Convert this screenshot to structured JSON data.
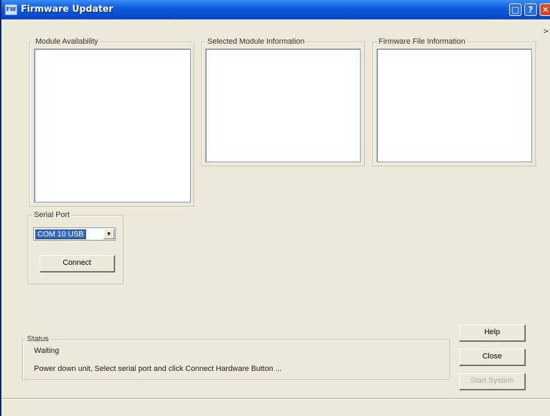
{
  "window": {
    "title": "Firmware Updater",
    "icon_text": "FW",
    "buttons": {
      "maximize": "□",
      "help": "?",
      "close": "✕"
    },
    "overflow_chevron": ">>"
  },
  "panels": {
    "module_availability": {
      "label": "Module Availability"
    },
    "selected_module_info": {
      "label": "Selected Module Information"
    },
    "firmware_file_info": {
      "label": "Firmware File Information"
    }
  },
  "serial_port": {
    "label": "Serial Port",
    "selected": "COM 10 USB",
    "connect_label": "Connect"
  },
  "status": {
    "label": "Status",
    "state": "Waiting",
    "message": "Power down unit, Select serial port and click Connect Hardware Button ..."
  },
  "actions": {
    "help_label": "Help",
    "close_label": "Close",
    "start_label": "Start System"
  }
}
